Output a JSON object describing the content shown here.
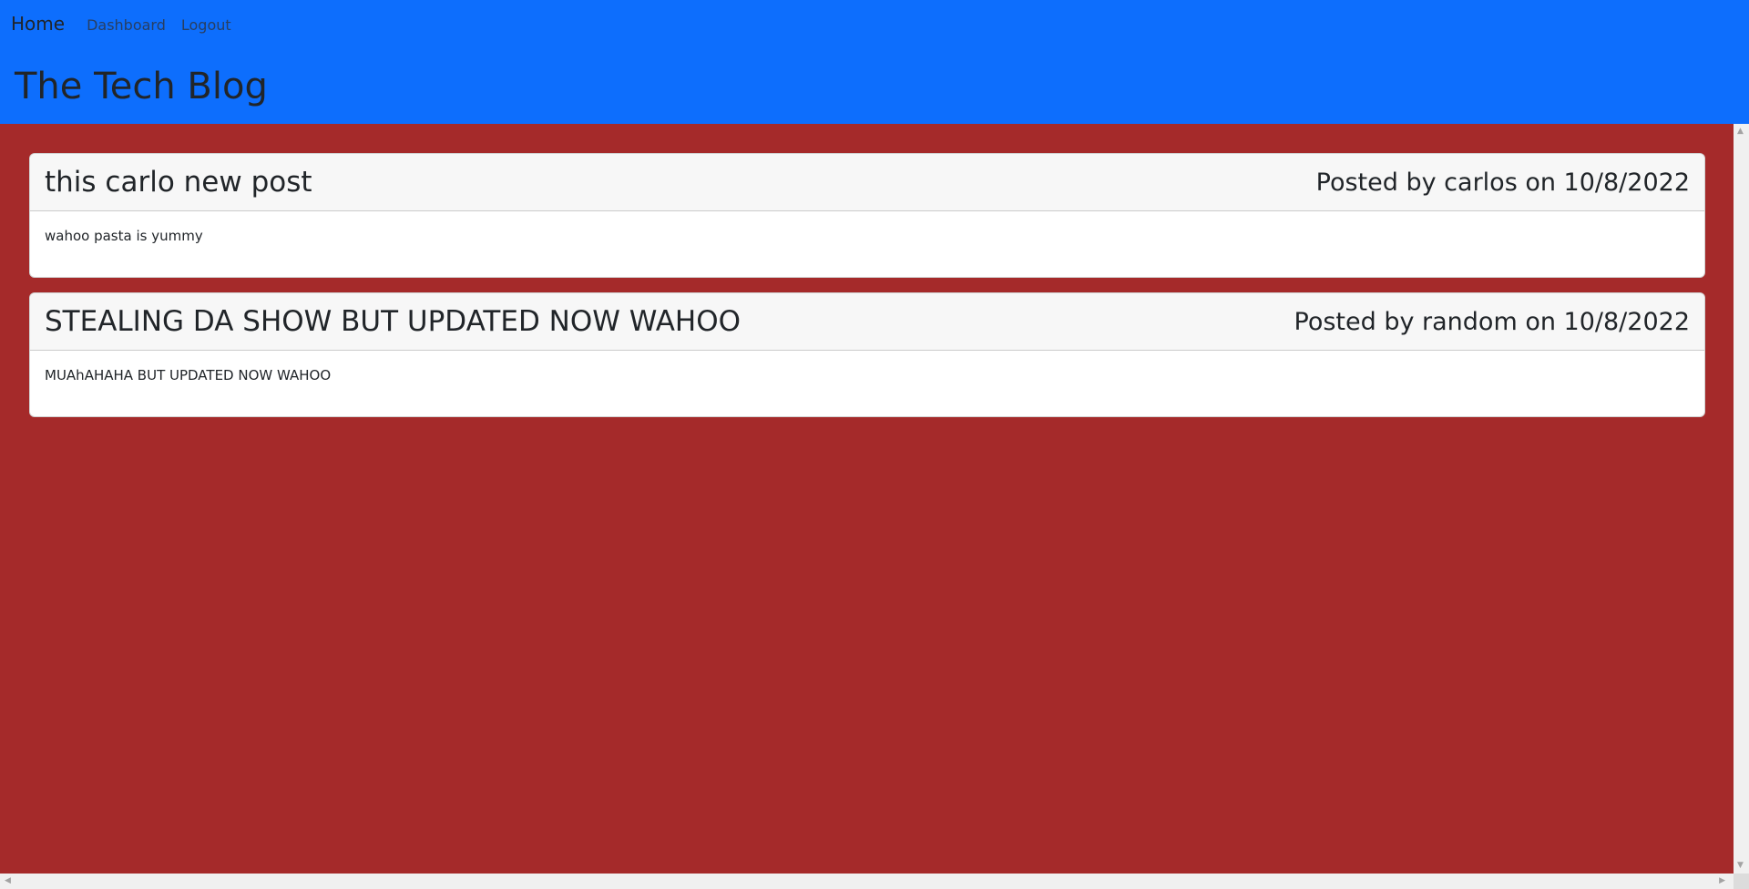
{
  "nav": {
    "home": "Home",
    "dashboard": "Dashboard",
    "logout": "Logout"
  },
  "site": {
    "title": "The Tech Blog"
  },
  "posts": [
    {
      "title": "this carlo new post",
      "meta": "Posted by carlos on 10/8/2022",
      "content": "wahoo pasta is yummy"
    },
    {
      "title": "STEALING DA SHOW BUT UPDATED NOW WAHOO",
      "meta": "Posted by random on 10/8/2022",
      "content": "MUAhAHAHA BUT UPDATED NOW WAHOO"
    }
  ],
  "colors": {
    "header_bg": "#0d6efd",
    "page_bg": "#a52a2a",
    "card_header_bg": "#f7f7f7"
  },
  "icons": {
    "scroll_up": "▲",
    "scroll_down": "▼",
    "scroll_left": "◀",
    "scroll_right": "▶"
  }
}
